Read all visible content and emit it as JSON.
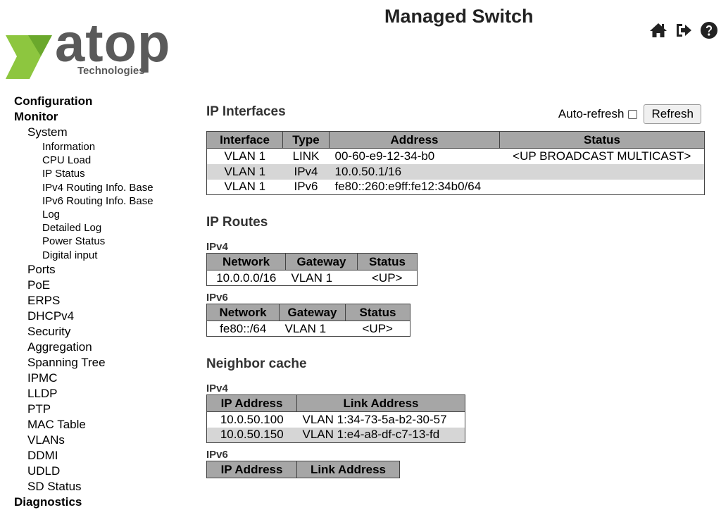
{
  "header": {
    "title": "Managed Switch",
    "logo_text": "atop",
    "logo_sub": "Technologies",
    "icons": [
      "home-icon",
      "logout-icon",
      "help-icon"
    ]
  },
  "sidebar": {
    "configuration": "Configuration",
    "monitor": "Monitor",
    "system": "System",
    "system_items": [
      "Information",
      "CPU Load",
      "IP Status",
      "IPv4 Routing Info. Base",
      "IPv6 Routing Info. Base",
      "Log",
      "Detailed Log",
      "Power Status",
      "Digital input"
    ],
    "monitor_items": [
      "Ports",
      "PoE",
      "ERPS",
      "DHCPv4",
      "Security",
      "Aggregation",
      "Spanning Tree",
      "IPMC",
      "LLDP",
      "PTP",
      "MAC Table",
      "VLANs",
      "DDMI",
      "UDLD",
      "SD Status"
    ],
    "diagnostics": "Diagnostics"
  },
  "main": {
    "ip_interfaces_title": "IP Interfaces",
    "auto_refresh_label": "Auto-refresh",
    "refresh_button": "Refresh",
    "interfaces": {
      "headers": [
        "Interface",
        "Type",
        "Address",
        "Status"
      ],
      "rows": [
        [
          "VLAN 1",
          "LINK",
          "00-60-e9-12-34-b0",
          "<UP BROADCAST MULTICAST>"
        ],
        [
          "VLAN 1",
          "IPv4",
          "10.0.50.1/16",
          ""
        ],
        [
          "VLAN 1",
          "IPv6",
          "fe80::260:e9ff:fe12:34b0/64",
          ""
        ]
      ]
    },
    "ip_routes_title": "IP Routes",
    "routes_ipv4_label": "IPv4",
    "routes_ipv4": {
      "headers": [
        "Network",
        "Gateway",
        "Status"
      ],
      "rows": [
        [
          "10.0.0.0/16",
          "VLAN 1",
          "<UP>"
        ]
      ]
    },
    "routes_ipv6_label": "IPv6",
    "routes_ipv6": {
      "headers": [
        "Network",
        "Gateway",
        "Status"
      ],
      "rows": [
        [
          "fe80::/64",
          "VLAN 1",
          "<UP>"
        ]
      ]
    },
    "neighbor_title": "Neighbor cache",
    "neighbor_ipv4_label": "IPv4",
    "neighbor_ipv4": {
      "headers": [
        "IP Address",
        "Link Address"
      ],
      "rows": [
        [
          "10.0.50.100",
          "VLAN 1:34-73-5a-b2-30-57"
        ],
        [
          "10.0.50.150",
          "VLAN 1:e4-a8-df-c7-13-fd"
        ]
      ]
    },
    "neighbor_ipv6_label": "IPv6",
    "neighbor_ipv6": {
      "headers": [
        "IP Address",
        "Link Address"
      ],
      "rows": []
    }
  },
  "colors": {
    "table_header": "#a6a6a6",
    "row_alt": "#d6d6d6",
    "logo_green": "#8dc63f",
    "logo_gray": "#5a5a5a"
  }
}
